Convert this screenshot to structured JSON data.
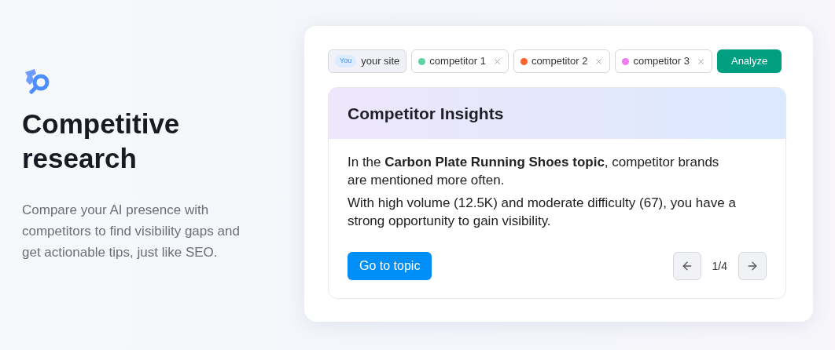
{
  "intro": {
    "title": "Competitive research",
    "description": "Compare your AI presence with competitors to find visibility gaps and get actionable tips, just like SEO."
  },
  "site_chip": {
    "badge": "You",
    "label": "your site"
  },
  "competitors": [
    {
      "label": "competitor 1",
      "color": "#5fd3a4"
    },
    {
      "label": "competitor 2",
      "color": "#ff642d"
    },
    {
      "label": "competitor 3",
      "color": "#f27af0"
    }
  ],
  "analyze_button": "Analyze",
  "insights": {
    "title": "Competitor Insights",
    "paragraphs": [
      "In the **Carbon Plate Running Shoes topic**, competitor brands are mentioned more often.",
      "With high volume (12.5K) and moderate difficulty (67), you have a strong opportunity to gain visibility."
    ],
    "action_button": "Go to topic",
    "pager": "1/4"
  }
}
